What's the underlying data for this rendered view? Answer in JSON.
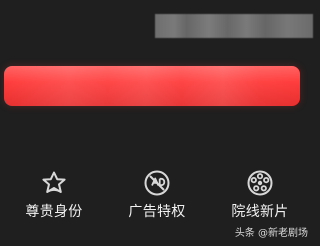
{
  "features": [
    {
      "label": "尊贵身份",
      "icon": "crown-star-icon"
    },
    {
      "label": "广告特权",
      "icon": "no-ads-icon"
    },
    {
      "label": "院线新片",
      "icon": "film-reel-icon"
    }
  ],
  "watermark": "头条 @新老剧场",
  "colors": {
    "background": "#1f1f1f",
    "banner": "#ff3d3d",
    "text": "#f1f1f1"
  }
}
